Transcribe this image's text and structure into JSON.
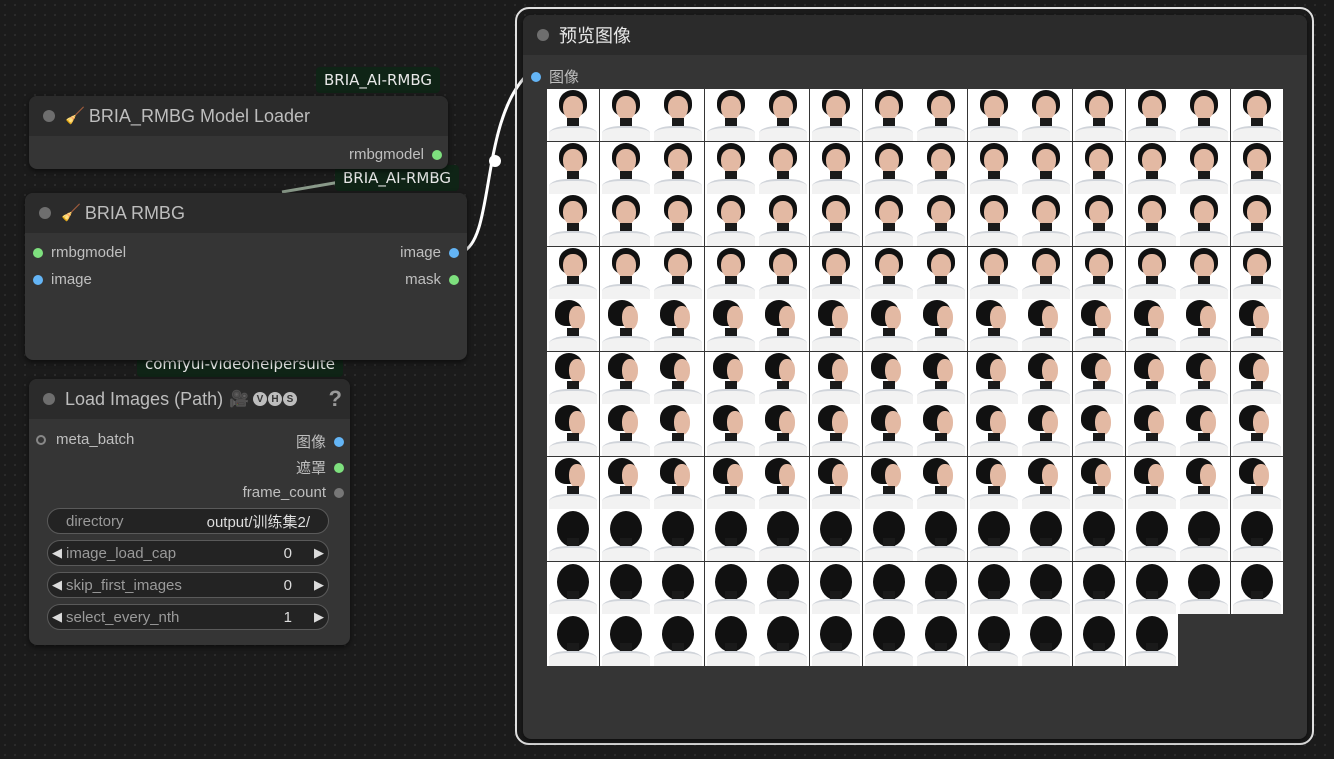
{
  "badges": {
    "loader_group": "BRIA_AI-RMBG",
    "rmbg_group": "BRIA_AI-RMBG",
    "vhs_group": "comfyui-videohelpersuite"
  },
  "model_loader": {
    "title": "BRIA_RMBG Model Loader",
    "output_label": "rmbgmodel"
  },
  "rmbg": {
    "title": "BRIA RMBG",
    "inputs": [
      "rmbgmodel",
      "image"
    ],
    "outputs": [
      "image",
      "mask"
    ]
  },
  "load_images": {
    "title": "Load Images (Path)",
    "badge_letters": [
      "V",
      "H",
      "S"
    ],
    "help": "?",
    "input_label": "meta_batch",
    "outputs": [
      "图像",
      "遮罩",
      "frame_count"
    ],
    "widgets": {
      "directory": {
        "label": "directory",
        "value": "output/训练集2/"
      },
      "image_load_cap": {
        "label": "image_load_cap",
        "value": "0"
      },
      "skip_first_images": {
        "label": "skip_first_images",
        "value": "0"
      },
      "select_every_nth": {
        "label": "select_every_nth",
        "value": "1"
      }
    }
  },
  "preview": {
    "title": "预览图像",
    "input_label": "图像",
    "image_count": 152
  },
  "icons": {
    "broom": "broom-icon",
    "camera": "film-camera-icon"
  },
  "colors": {
    "model_slot": "#7ee07e",
    "image_slot": "#64b5f6",
    "mask_slot": "#7ec87e",
    "badge_bg": "#0f2416"
  }
}
